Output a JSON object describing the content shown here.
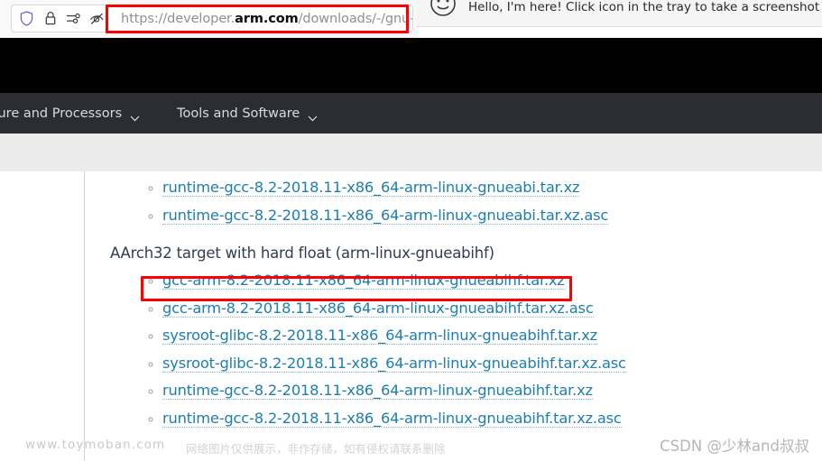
{
  "browser": {
    "toolbar_icons": [
      {
        "name": "shield-icon",
        "label": "Enhanced Tracking Protection"
      },
      {
        "name": "lock-icon",
        "label": "Connection secure"
      },
      {
        "name": "permissions-icon",
        "label": "Site permissions"
      },
      {
        "name": "eye-slash-icon",
        "label": "Tracking blocked"
      }
    ],
    "url": {
      "prefix": "https://developer.",
      "domain": "arm.com",
      "suffix": "/downloads/-/gnu-a",
      "full": "https://developer.arm.com/downloads/-/gnu-a"
    },
    "highlight_color": "#ff0000"
  },
  "notification": {
    "icon": "smiley-face-icon",
    "text": "Hello, I'm here! Click icon in the tray to take a screenshot or"
  },
  "site_nav": {
    "items": [
      {
        "label": "nitecture and Processors",
        "icon": "chevron-down-icon",
        "truncated": true
      },
      {
        "label": "Tools and Software",
        "icon": "chevron-down-icon",
        "truncated": false
      }
    ]
  },
  "page": {
    "groups": [
      {
        "heading": null,
        "links": [
          "runtime-gcc-8.2-2018.11-x86_64-arm-linux-gnueabi.tar.xz",
          "runtime-gcc-8.2-2018.11-x86_64-arm-linux-gnueabi.tar.xz.asc"
        ]
      },
      {
        "heading": "AArch32 target with hard float (arm-linux-gnueabihf)",
        "links": [
          "gcc-arm-8.2-2018.11-x86_64-arm-linux-gnueabihf.tar.xz",
          "gcc-arm-8.2-2018.11-x86_64-arm-linux-gnueabihf.tar.xz.asc",
          "sysroot-glibc-8.2-2018.11-x86_64-arm-linux-gnueabihf.tar.xz",
          "sysroot-glibc-8.2-2018.11-x86_64-arm-linux-gnueabihf.tar.xz.asc",
          "runtime-gcc-8.2-2018.11-x86_64-arm-linux-gnueabihf.tar.xz",
          "runtime-gcc-8.2-2018.11-x86_64-arm-linux-gnueabihf.tar.xz.asc"
        ]
      }
    ],
    "highlighted_link": "gcc-arm-8.2-2018.11-x86_64-arm-linux-gnueabihf.tar.xz",
    "link_color": "#1d7eb0",
    "heading_color": "#2f3e50"
  },
  "watermarks": {
    "left": "www.toymoban.com",
    "left_secondary": "网络图片仅供展示，非作存储，如有侵权请联系删除",
    "right": "CSDN @少林and叔叔"
  }
}
